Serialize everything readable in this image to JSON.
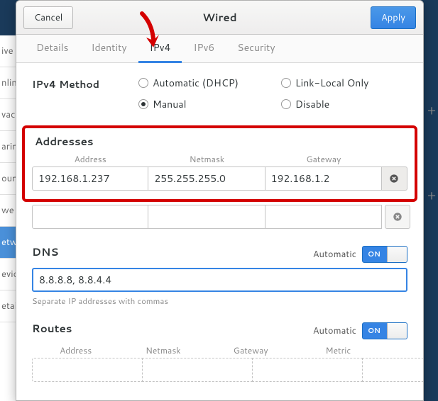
{
  "header": {
    "title": "Wired",
    "cancel": "Cancel",
    "apply": "Apply"
  },
  "tabs": {
    "details": "Details",
    "identity": "Identity",
    "ipv4": "IPv4",
    "ipv6": "IPv6",
    "security": "Security"
  },
  "method": {
    "label": "IPv4 Method",
    "automatic": "Automatic (DHCP)",
    "link_local": "Link-Local Only",
    "manual": "Manual",
    "disable": "Disable",
    "selected": "manual"
  },
  "addresses": {
    "title": "Addresses",
    "cols": {
      "address": "Address",
      "netmask": "Netmask",
      "gateway": "Gateway"
    },
    "rows": [
      {
        "address": "192.168.1.237",
        "netmask": "255.255.255.0",
        "gateway": "192.168.1.2"
      }
    ]
  },
  "dns": {
    "title": "DNS",
    "automatic_label": "Automatic",
    "switch_on": "ON",
    "value": "8.8.8.8, 8.8.4.4",
    "hint": "Separate IP addresses with commas"
  },
  "routes": {
    "title": "Routes",
    "automatic_label": "Automatic",
    "switch_on": "ON",
    "cols": {
      "address": "Address",
      "netmask": "Netmask",
      "gateway": "Gateway",
      "metric": "Metric"
    }
  }
}
